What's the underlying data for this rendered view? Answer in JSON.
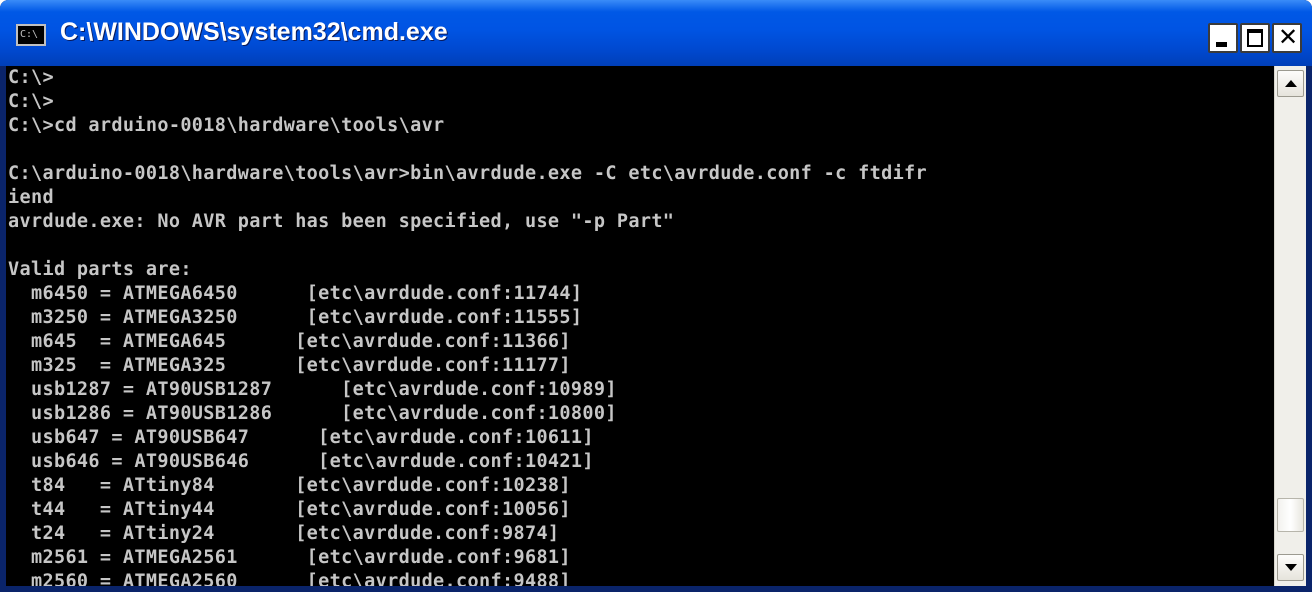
{
  "window": {
    "title": "C:\\WINDOWS\\system32\\cmd.exe",
    "icon": "cmd-prompt-icon",
    "icon_label": "C:\\",
    "buttons": {
      "minimize": "minimize-icon",
      "maximize": "maximize-icon",
      "close_glyph": "✕"
    }
  },
  "console": {
    "foreground": "#c6c6c6",
    "background": "#000000",
    "lines": [
      "C:\\>",
      "C:\\>",
      "C:\\>cd arduino-0018\\hardware\\tools\\avr",
      "",
      "C:\\arduino-0018\\hardware\\tools\\avr>bin\\avrdude.exe -C etc\\avrdude.conf -c ftdifr",
      "iend",
      "avrdude.exe: No AVR part has been specified, use \"-p Part\"",
      "",
      "Valid parts are:",
      "  m6450 = ATMEGA6450      [etc\\avrdude.conf:11744]",
      "  m3250 = ATMEGA3250      [etc\\avrdude.conf:11555]",
      "  m645  = ATMEGA645      [etc\\avrdude.conf:11366]",
      "  m325  = ATMEGA325      [etc\\avrdude.conf:11177]",
      "  usb1287 = AT90USB1287      [etc\\avrdude.conf:10989]",
      "  usb1286 = AT90USB1286      [etc\\avrdude.conf:10800]",
      "  usb647 = AT90USB647      [etc\\avrdude.conf:10611]",
      "  usb646 = AT90USB646      [etc\\avrdude.conf:10421]",
      "  t84   = ATtiny84       [etc\\avrdude.conf:10238]",
      "  t44   = ATtiny44       [etc\\avrdude.conf:10056]",
      "  t24   = ATtiny24       [etc\\avrdude.conf:9874]",
      "  m2561 = ATMEGA2561      [etc\\avrdude.conf:9681]",
      "  m2560 = ATMEGA2560      [etc\\avrdude.conf:9488]"
    ]
  },
  "scrollbar": {
    "up": "scroll-up-arrow-icon",
    "down": "scroll-down-arrow-icon"
  }
}
